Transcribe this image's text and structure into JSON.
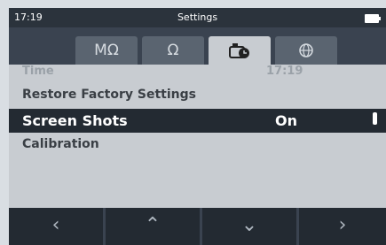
{
  "status": {
    "time": "17:19",
    "title": "Settings"
  },
  "tabs": [
    {
      "label": "MΩ",
      "icon": "megohm-icon"
    },
    {
      "label": "Ω",
      "icon": "ohm-icon"
    },
    {
      "label": "",
      "icon": "settings-clock-icon"
    },
    {
      "label": "",
      "icon": "globe-icon"
    }
  ],
  "rows": [
    {
      "label": "Time",
      "value": "17:19"
    },
    {
      "label": "Restore Factory Settings",
      "value": ""
    },
    {
      "label": "Screen Shots",
      "value": "On"
    },
    {
      "label": "Calibration",
      "value": ""
    }
  ],
  "softkeys": [
    "‹",
    "⌃",
    "⌄",
    "›"
  ]
}
